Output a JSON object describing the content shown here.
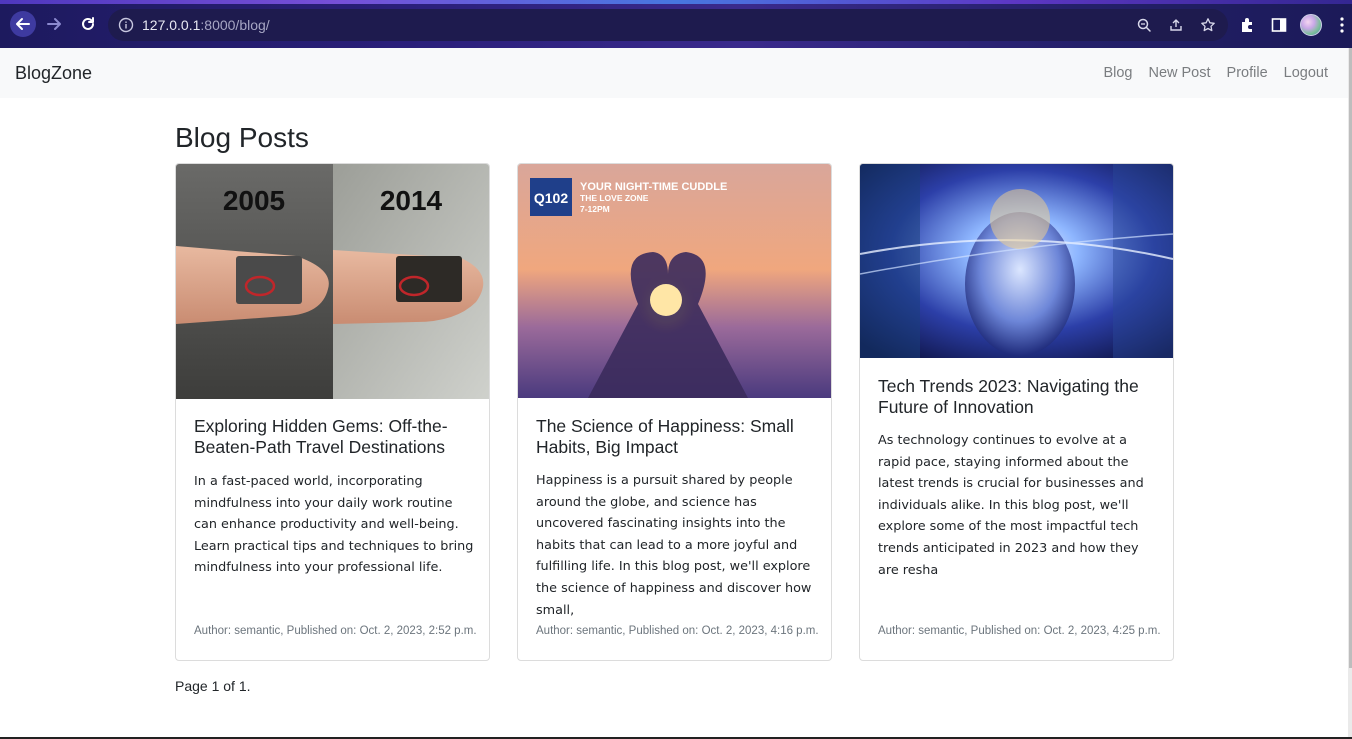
{
  "browser": {
    "url_host": "127.0.0.1",
    "url_rest": ":8000/blog/"
  },
  "navbar": {
    "brand": "BlogZone",
    "links": [
      "Blog",
      "New Post",
      "Profile",
      "Logout"
    ]
  },
  "main": {
    "title": "Blog Posts",
    "posts": [
      {
        "image_labels": [
          "2005",
          "2014"
        ],
        "title": "Exploring Hidden Gems: Off-the-Beaten-Path Travel Destinations",
        "excerpt": "In a fast-paced world, incorporating mindfulness into your daily work routine can enhance productivity and well-being. Learn practical tips and techniques to bring mindfulness into your professional life.",
        "meta": "Author: semantic, Published on: Oct. 2, 2023, 2:52 p.m."
      },
      {
        "image_labels": [
          "Q102",
          "YOUR NIGHT-TIME CUDDLE",
          "THE LOVE ZONE",
          "7-12PM"
        ],
        "title": "The Science of Happiness: Small Habits, Big Impact",
        "excerpt": "Happiness is a pursuit shared by people around the globe, and science has uncovered fascinating insights into the habits that can lead to a more joyful and fulfilling life. In this blog post, we'll explore the science of happiness and discover how small,",
        "meta": "Author: semantic, Published on: Oct. 2, 2023, 4:16 p.m."
      },
      {
        "image_labels": [],
        "title": "Tech Trends 2023: Navigating the Future of Innovation",
        "excerpt": "As technology continues to evolve at a rapid pace, staying informed about the latest trends is crucial for businesses and individuals alike. In this blog post, we'll explore some of the most impactful tech trends anticipated in 2023 and how they are resha",
        "meta": "Author: semantic, Published on: Oct. 2, 2023, 4:25 p.m."
      }
    ],
    "pagination": "Page 1 of 1."
  },
  "colors": {
    "navbar_bg": "#f8f9fa",
    "meta_text": "#6c757d",
    "chrome_bg": "#24206a"
  }
}
